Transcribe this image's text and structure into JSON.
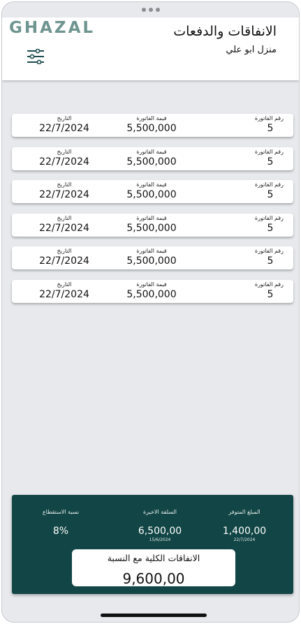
{
  "header": {
    "brand": "GHAZAL",
    "title": "الانفاقات والدفعات",
    "subtitle": "منزل ابو علي",
    "menu_icon": "sliders-icon"
  },
  "invoices": {
    "labels": {
      "number": "رقم الفاتورة",
      "amount": "قيمة الفاتورة",
      "date": "التاريخ"
    },
    "rows": [
      {
        "number": "5",
        "amount": "5,500,000",
        "date": "22/7/2024"
      },
      {
        "number": "5",
        "amount": "5,500,000",
        "date": "22/7/2024"
      },
      {
        "number": "5",
        "amount": "5,500,000",
        "date": "22/7/2024"
      },
      {
        "number": "5",
        "amount": "5,500,000",
        "date": "22/7/2024"
      },
      {
        "number": "5",
        "amount": "5,500,000",
        "date": "22/7/2024"
      },
      {
        "number": "5",
        "amount": "5,500,000",
        "date": "22/7/2024"
      }
    ]
  },
  "summary": {
    "available_label": "المبلغ المتوفر",
    "available_value": "1,400,00",
    "available_date": "22/7/2024",
    "advance_label": "السلفة الاخيرة",
    "advance_value": "6,500,00",
    "advance_date": "15/6/2024",
    "deduction_label": "نسبة الاستقطاع",
    "deduction_value": "8%",
    "total_label": "الانفاقات الكلية مع النسبة",
    "total_value": "9,600,00"
  },
  "colors": {
    "summary_bg": "#124545",
    "brand": "#6f9590",
    "page_bg": "#e8e9ed"
  }
}
